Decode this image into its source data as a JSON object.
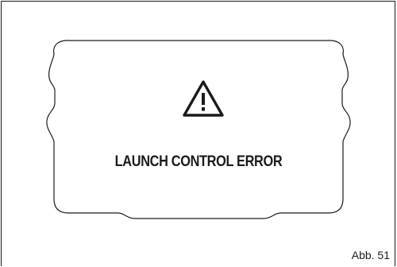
{
  "display": {
    "warning_icon": "warning-triangle-icon",
    "message": "LAUNCH CONTROL ERROR"
  },
  "figure": {
    "label": "Abb. 51"
  },
  "colors": {
    "line": "#1a1a1a",
    "background": "#ffffff"
  }
}
